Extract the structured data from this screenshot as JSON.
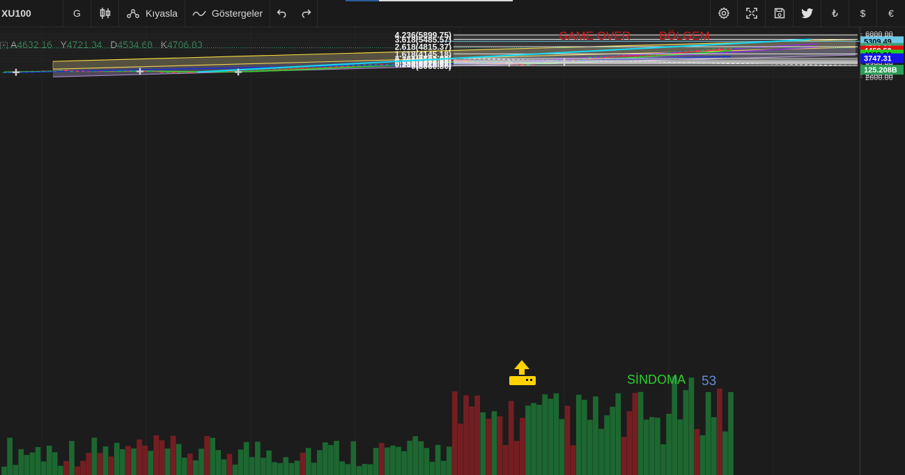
{
  "toolbar": {
    "symbol": "XU100",
    "interval": "G",
    "compare_label": "Kıyasla",
    "indicators_label": "Göstergeler",
    "currency_try": "₺",
    "currency_usd": "$",
    "currency_eur": "€"
  },
  "ohlc": {
    "open_label": "A",
    "open": "4632.16",
    "high_label": "Y",
    "high": "4721.34",
    "low_label": "D",
    "low": "4534.68",
    "close_label": "K",
    "close": "4706.83"
  },
  "colors": {
    "background": "#1c1c1c",
    "up": "#26a65b",
    "down": "#e8495a",
    "fib_line": "#e8e8e8",
    "channel": "#ffe13a",
    "trend_arrow": "#19d8f0",
    "ma_fast": "#e8303a",
    "ma_mid": "#33d42e",
    "ma_slow": "#1b2fd6",
    "parallel": "#8a2be2"
  },
  "chart_data": {
    "type": "candlestick",
    "y_axis": {
      "min": 2000,
      "max": 6000,
      "step": 200,
      "ticks": [
        "6000.00",
        "5800.00",
        "5600.00",
        "5400.00",
        "5200.00",
        "5000.00",
        "4800.00",
        "4600.00",
        "4400.00",
        "4200.00",
        "4000.00",
        "3800.00",
        "3600.00",
        "3400.00",
        "3200.00",
        "3000.00",
        "2800.00",
        "2600.00",
        "2400.00",
        "2200.00",
        "2000.00"
      ]
    },
    "price_tags": [
      {
        "value": 5309.49,
        "label": "5309.49",
        "color": "#6ec8e6",
        "text_color": "#0a0a0a"
      },
      {
        "value": 4706.83,
        "label": "4706.83",
        "color": "#3f9f72",
        "text_color": "#ffffff"
      },
      {
        "value": 4458.5,
        "label": "4458.50",
        "color": "#e01010",
        "text_color": "#ffffff"
      },
      {
        "value": 4083.96,
        "label": "4083.96",
        "color": "#20d020",
        "text_color": "#0a0a0a"
      },
      {
        "value": 3747.31,
        "label": "3747.31",
        "color": "#1414e8",
        "text_color": "#ffffff"
      },
      {
        "value": 2690,
        "label": "125.208B",
        "color": "#2a9d54",
        "text_color": "#ffffff"
      }
    ],
    "fib_levels": [
      {
        "label": "4.236(5899.75)",
        "value": 5899.75
      },
      {
        "label": "3.618(5485.57)",
        "value": 5485.57
      },
      {
        "label": "2.618(4815.37)",
        "value": 4815.37
      },
      {
        "label": "1.618(4145.18)",
        "value": 4145.18
      },
      {
        "label": "1(3731.00)",
        "value": 3731.0
      },
      {
        "label": "0.786(3587.57)",
        "value": 3587.57
      },
      {
        "label": "0.618(3474.98)",
        "value": 3474.98
      },
      {
        "label": "0.5(3395.90)",
        "value": 3395.9
      },
      {
        "label": "0.382(3316.82)",
        "value": 3316.82
      },
      {
        "label": "0.236(3218.97)",
        "value": 3218.97
      },
      {
        "label": "0(3060.80)",
        "value": 3060.8
      }
    ],
    "annotations": {
      "game_over": "GAME OVER",
      "zone": "BÖLGEM",
      "sindoma": "SİNDOMA",
      "sindoma_num": "53"
    },
    "candles": [
      [
        2450,
        2480,
        2430,
        2470
      ],
      [
        2470,
        2500,
        2460,
        2490
      ],
      [
        2490,
        2520,
        2480,
        2510
      ],
      [
        2510,
        2530,
        2500,
        2520
      ],
      [
        2520,
        2540,
        2510,
        2535
      ],
      [
        2535,
        2555,
        2520,
        2545
      ],
      [
        2545,
        2570,
        2535,
        2560
      ],
      [
        2560,
        2580,
        2550,
        2570
      ],
      [
        2570,
        2590,
        2560,
        2585
      ],
      [
        2585,
        2600,
        2570,
        2590
      ],
      [
        2590,
        2700,
        2580,
        2670
      ],
      [
        2670,
        2690,
        2530,
        2560
      ],
      [
        2560,
        2580,
        2530,
        2570
      ],
      [
        2570,
        2590,
        2550,
        2560
      ],
      [
        2560,
        2580,
        2530,
        2545
      ],
      [
        2545,
        2560,
        2520,
        2530
      ],
      [
        2530,
        2555,
        2515,
        2550
      ],
      [
        2550,
        2570,
        2530,
        2535
      ],
      [
        2535,
        2555,
        2520,
        2545
      ],
      [
        2545,
        2560,
        2530,
        2540
      ],
      [
        2540,
        2570,
        2530,
        2560
      ],
      [
        2560,
        2590,
        2550,
        2580
      ],
      [
        2580,
        2600,
        2560,
        2570
      ],
      [
        2570,
        2590,
        2555,
        2585
      ],
      [
        2585,
        2595,
        2560,
        2565
      ],
      [
        2565,
        2580,
        2540,
        2550
      ],
      [
        2550,
        2570,
        2530,
        2560
      ],
      [
        2560,
        2570,
        2480,
        2500
      ],
      [
        2500,
        2520,
        2400,
        2420
      ],
      [
        2420,
        2470,
        2400,
        2460
      ],
      [
        2460,
        2480,
        2430,
        2440
      ],
      [
        2440,
        2460,
        2410,
        2450
      ],
      [
        2450,
        2480,
        2440,
        2470
      ],
      [
        2470,
        2490,
        2455,
        2465
      ],
      [
        2465,
        2500,
        2460,
        2495
      ],
      [
        2495,
        2520,
        2480,
        2510
      ],
      [
        2510,
        2530,
        2490,
        2500
      ],
      [
        2500,
        2520,
        2485,
        2515
      ],
      [
        2515,
        2540,
        2505,
        2530
      ],
      [
        2530,
        2560,
        2520,
        2550
      ],
      [
        2550,
        2570,
        2530,
        2540
      ],
      [
        2540,
        2560,
        2520,
        2555
      ],
      [
        2555,
        2590,
        2545,
        2580
      ],
      [
        2580,
        2620,
        2570,
        2610
      ],
      [
        2610,
        2650,
        2600,
        2640
      ],
      [
        2640,
        2680,
        2630,
        2670
      ],
      [
        2670,
        2700,
        2650,
        2690
      ],
      [
        2690,
        2730,
        2680,
        2720
      ],
      [
        2720,
        2760,
        2700,
        2750
      ],
      [
        2750,
        2790,
        2740,
        2780
      ],
      [
        2780,
        2820,
        2770,
        2810
      ],
      [
        2810,
        2850,
        2790,
        2840
      ],
      [
        2840,
        2870,
        2820,
        2860
      ],
      [
        2860,
        2880,
        2820,
        2830
      ],
      [
        2830,
        2870,
        2820,
        2865
      ],
      [
        2865,
        2900,
        2850,
        2890
      ],
      [
        2890,
        2930,
        2870,
        2920
      ],
      [
        2920,
        2960,
        2900,
        2950
      ],
      [
        2950,
        3000,
        2940,
        2990
      ],
      [
        2990,
        3040,
        2980,
        3030
      ],
      [
        3030,
        3070,
        3010,
        3060
      ],
      [
        3060,
        3090,
        3040,
        3080
      ],
      [
        3080,
        3110,
        3060,
        3100
      ],
      [
        3100,
        3130,
        3080,
        3120
      ],
      [
        3120,
        3160,
        3100,
        3150
      ],
      [
        3150,
        3180,
        3130,
        3170
      ],
      [
        3170,
        3200,
        3150,
        3190
      ],
      [
        3190,
        3220,
        3160,
        3170
      ],
      [
        3170,
        3210,
        3160,
        3200
      ],
      [
        3200,
        3240,
        3180,
        3230
      ],
      [
        3230,
        3270,
        3210,
        3260
      ],
      [
        3260,
        3310,
        3250,
        3300
      ],
      [
        3300,
        3360,
        3280,
        3350
      ],
      [
        3350,
        3400,
        3330,
        3390
      ],
      [
        3390,
        3440,
        3370,
        3430
      ],
      [
        3430,
        3480,
        3410,
        3470
      ],
      [
        3470,
        3530,
        3450,
        3520
      ],
      [
        3520,
        3600,
        3500,
        3590
      ],
      [
        3590,
        3650,
        3570,
        3640
      ],
      [
        3640,
        3740,
        3620,
        3730
      ],
      [
        3730,
        3740,
        3400,
        3460
      ],
      [
        3460,
        3500,
        3380,
        3420
      ],
      [
        3420,
        3440,
        3300,
        3340
      ],
      [
        3340,
        3380,
        3260,
        3280
      ],
      [
        3280,
        3320,
        3220,
        3230
      ],
      [
        3230,
        3300,
        3220,
        3290
      ],
      [
        3290,
        3330,
        3260,
        3270
      ],
      [
        3270,
        3310,
        3250,
        3300
      ],
      [
        3300,
        3340,
        3280,
        3290
      ],
      [
        3290,
        3310,
        3230,
        3240
      ],
      [
        3240,
        3270,
        3180,
        3200
      ],
      [
        3200,
        3230,
        3140,
        3150
      ],
      [
        3150,
        3170,
        3060,
        3100
      ],
      [
        3100,
        3240,
        3090,
        3230
      ],
      [
        3230,
        3400,
        3220,
        3390
      ],
      [
        3390,
        3460,
        3380,
        3450
      ],
      [
        3450,
        3500,
        3420,
        3480
      ],
      [
        3480,
        3560,
        3470,
        3550
      ],
      [
        3550,
        3600,
        3540,
        3580
      ],
      [
        3580,
        3610,
        3560,
        3600
      ],
      [
        3600,
        3610,
        3550,
        3560
      ],
      [
        3560,
        3580,
        3520,
        3540
      ],
      [
        3540,
        3600,
        3520,
        3590
      ],
      [
        3590,
        3700,
        3580,
        3680
      ],
      [
        3680,
        3890,
        3670,
        3880
      ],
      [
        3880,
        3920,
        3850,
        3900
      ],
      [
        3900,
        3940,
        3870,
        3920
      ],
      [
        3920,
        3960,
        3900,
        3940
      ],
      [
        3940,
        3990,
        3920,
        3970
      ],
      [
        3970,
        4020,
        3950,
        4000
      ],
      [
        4000,
        4030,
        3970,
        3990
      ],
      [
        3990,
        4010,
        3940,
        3960
      ],
      [
        3960,
        3980,
        3890,
        3910
      ],
      [
        3910,
        4000,
        3900,
        3990
      ],
      [
        3990,
        4060,
        3980,
        4050
      ],
      [
        4050,
        4100,
        4030,
        4080
      ],
      [
        4080,
        4110,
        4060,
        4100
      ],
      [
        4100,
        4220,
        4090,
        4210
      ],
      [
        4210,
        4330,
        4200,
        4320
      ],
      [
        4320,
        4380,
        4300,
        4370
      ],
      [
        4370,
        4420,
        4340,
        4400
      ],
      [
        4400,
        4450,
        4380,
        4430
      ],
      [
        4430,
        4480,
        4400,
        4460
      ],
      [
        4460,
        4500,
        4380,
        4400
      ],
      [
        4400,
        4530,
        4390,
        4520
      ],
      [
        4520,
        4560,
        4490,
        4550
      ],
      [
        4550,
        4640,
        4530,
        4630
      ],
      [
        4630,
        4670,
        4500,
        4540
      ],
      [
        4540,
        4680,
        4530,
        4660
      ],
      [
        4632.16,
        4721.34,
        4534.68,
        4706.83
      ]
    ]
  }
}
